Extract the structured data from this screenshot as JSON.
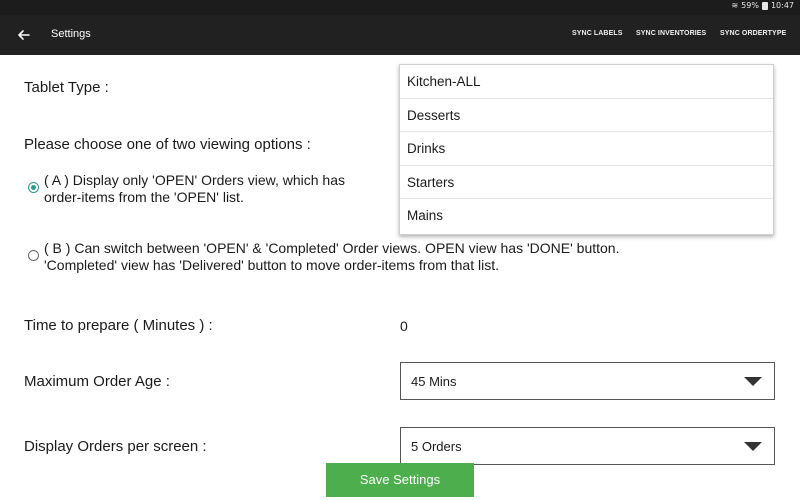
{
  "status_bar": {
    "battery": "59%",
    "time": "10:47"
  },
  "app_bar": {
    "title": "Settings",
    "actions": [
      "SYNC LABELS",
      "SYNC INVENTORIES",
      "SYNC ORDERTYPE"
    ]
  },
  "form": {
    "tablet_type_label": "Tablet Type :",
    "viewing_prompt": "Please choose one of two viewing options :",
    "option_a": {
      "line1": "( A ) Display only 'OPEN' Orders view, which has",
      "line2": "order-items from the 'OPEN' list.",
      "selected": true
    },
    "option_b": {
      "line1": "( B ) Can switch between 'OPEN' & 'Completed' Order views. OPEN view has 'DONE' button.",
      "line2": "'Completed' view has 'Delivered' button to move order-items from that list.",
      "selected": false
    },
    "time_to_prepare_label": "Time to prepare ( Minutes ) :",
    "time_to_prepare_value": "0",
    "max_order_age_label": "Maximum Order Age :",
    "max_order_age_value": "45 Mins",
    "orders_per_screen_label": "Display Orders per screen :",
    "orders_per_screen_value": "5 Orders"
  },
  "tablet_type_dropdown": {
    "options": [
      "Kitchen-ALL",
      "Desserts",
      "Drinks",
      "Starters",
      "Mains"
    ]
  },
  "save_button_label": "Save Settings",
  "colors": {
    "app_bar": "#212121",
    "radio_accent": "#2b9a8c",
    "save_button": "#4cae4c"
  }
}
